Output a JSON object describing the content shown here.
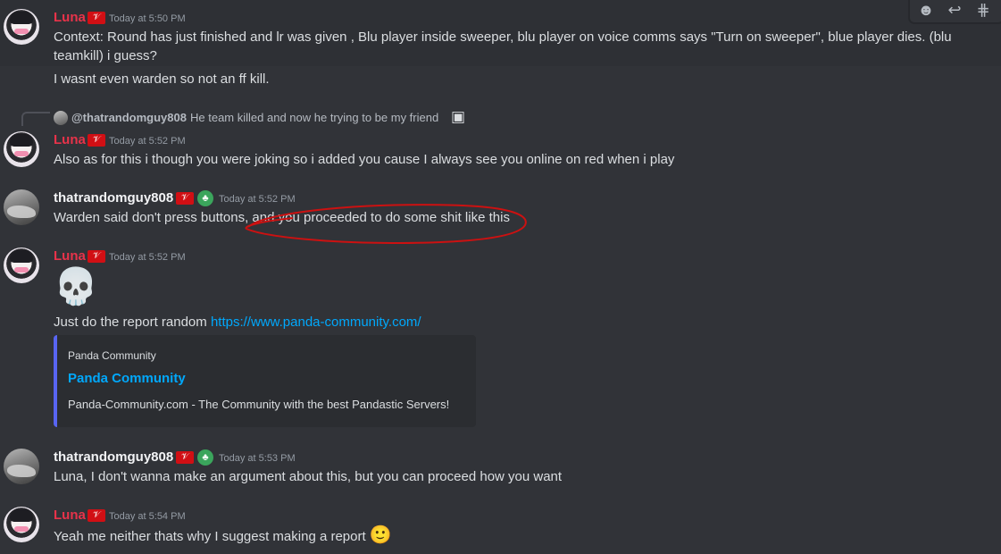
{
  "toolbar": {
    "reaction_icon": "☻",
    "reply_icon": "↩",
    "thread_icon": "⋕"
  },
  "messages": [
    {
      "author": "Luna",
      "flag_icon": "𝒱",
      "timestamp": "Today at 5:50 PM",
      "lines": [
        "Context: Round has just finished and lr was given , Blu player inside sweeper, blu player on voice comms says \"Turn on sweeper\", blue player dies. (blu",
        "teamkill) i guess?",
        "I wasnt even warden so not an ff kill."
      ]
    },
    {
      "reply": {
        "name": "@thatrandomguy808",
        "text": "He team killed and now he trying to be my friend",
        "image_icon": "▣"
      },
      "author": "Luna",
      "flag_icon": "𝒱",
      "timestamp": "Today at 5:52 PM",
      "lines": [
        "Also as for this i though you were joking so i added you cause I always see you online on red when i play"
      ]
    },
    {
      "author": "thatrandomguy808",
      "flag_icon": "𝒱",
      "badge_icon": "♣",
      "timestamp": "Today at 5:52 PM",
      "lines": [
        "Warden said don't press buttons, and you proceeded to do some shit like this"
      ]
    },
    {
      "author": "Luna",
      "flag_icon": "𝒱",
      "timestamp": "Today at 5:52 PM",
      "emoji": "💀",
      "line_prefix": "Just do the report random ",
      "link": "https://www.panda-community.com/",
      "embed": {
        "provider": "Panda Community",
        "title": "Panda Community",
        "description": "Panda-Community.com - The Community with the best Pandastic Servers!"
      }
    },
    {
      "author": "thatrandomguy808",
      "flag_icon": "𝒱",
      "badge_icon": "♣",
      "timestamp": "Today at 5:53 PM",
      "lines": [
        "Luna, I don't wanna make an argument about  this, but you can proceed how you want"
      ]
    },
    {
      "author": "Luna",
      "flag_icon": "𝒱",
      "timestamp": "Today at 5:54 PM",
      "lines": [
        "Yeah me neither thats why I suggest making a report"
      ],
      "emoji": "🙂"
    }
  ],
  "colors": {
    "background": "#313338",
    "luna_name": "#e8334a",
    "link": "#00a8fc",
    "annotation": "#cc1111"
  }
}
